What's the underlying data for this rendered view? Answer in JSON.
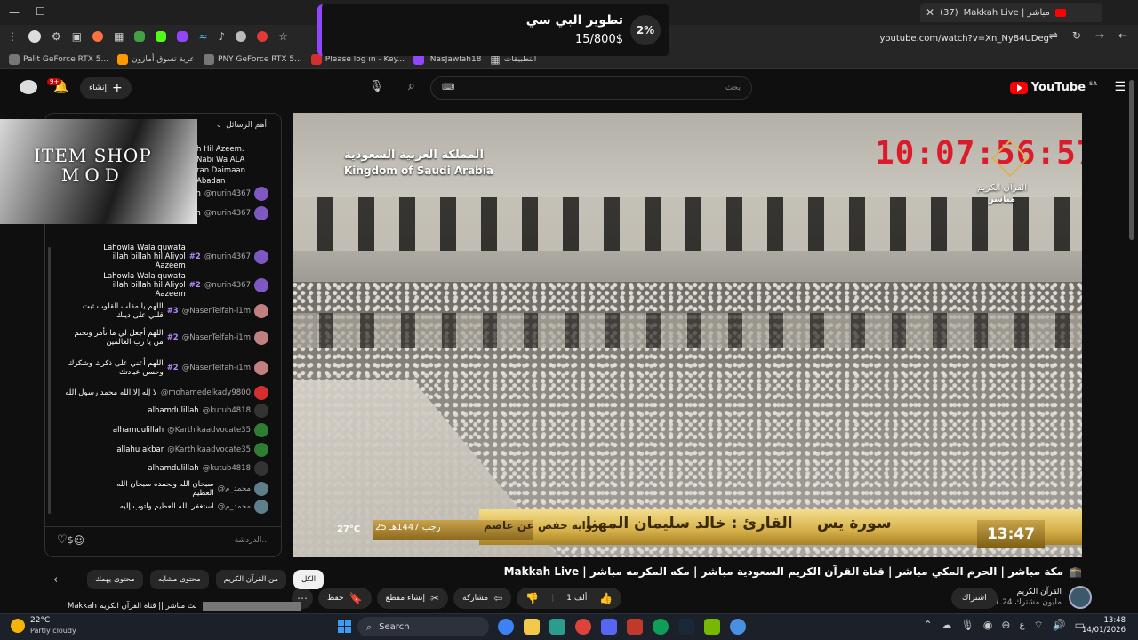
{
  "browser": {
    "tab_count_label": "(37)",
    "tab_title": "Makkah Live | مباشر",
    "new_tab_icon": "+",
    "url": "youtube.com/watch?v=Xn_Ny84UDeg",
    "bookmarks": [
      {
        "label": "التطبيقات",
        "color": "#4a4a4a"
      },
      {
        "label": "INasJawlah18",
        "color": "#9147ff"
      },
      {
        "label": "Please log in - Key...",
        "color": "#d32f2f"
      },
      {
        "label": "PNY GeForce RTX 5...",
        "color": "#555"
      },
      {
        "label": "عربة تسوق أمازون",
        "color": "#f90"
      },
      {
        "label": "Palit GeForce RTX 5...",
        "color": "#555"
      }
    ]
  },
  "donation": {
    "title": "تطوير البي سي",
    "amount": "15/800$",
    "percent": "2%"
  },
  "youtube": {
    "search_placeholder": "بحث",
    "logo_text": "YouTube",
    "logo_region": "SA",
    "create_label": "إنشاء",
    "notif_count": "9+"
  },
  "chat": {
    "header": "أهم الرسائل",
    "input_placeholder": "الدردشة...",
    "partial_top": [
      "h Hil Azeem.",
      "Nabi Wa ALA",
      "ran Daimaan",
      "Abadan"
    ],
    "messages": [
      {
        "user": "@nurin4367",
        "badge": "",
        "text": "iiaan abadan",
        "avatar": "#7e57c2"
      },
      {
        "user": "@nurin4367",
        "badge": "",
        "text": "billah hil Aliyol Aazeem",
        "avatar": "#7e57c2"
      },
      {
        "user": "@nurin4367",
        "badge": "#2",
        "text": "Lahowla Wala quwata illah billah hil Aliyol Aazeem",
        "avatar": "#7e57c2"
      },
      {
        "user": "@nurin4367",
        "badge": "#2",
        "text": "Lahowla Wala quwata illah billah hil Aliyol Aazeem",
        "avatar": "#7e57c2"
      },
      {
        "user": "@NaserTelfah-i1m",
        "badge": "#3",
        "text": "اللهم يا مقلب القلوب ثبت قلبي على دينك",
        "avatar": "#c08080"
      },
      {
        "user": "@NaserTelfah-i1m",
        "badge": "#2",
        "text": "اللهم أجعل لي ما تأمر وتحتم من يا رب العالمين",
        "avatar": "#c08080"
      },
      {
        "user": "@NaserTelfah-i1m",
        "badge": "#2",
        "text": "اللهم أعني على ذكرك وشكرك وحسن عبادتك",
        "avatar": "#c08080"
      },
      {
        "user": "@mohamedelkady9800",
        "badge": "",
        "text": "لا إله إلا الله محمد رسول الله",
        "avatar": "#d32f2f"
      },
      {
        "user": "@kutub4818",
        "badge": "",
        "text": "alhamdulillah",
        "avatar": "#333"
      },
      {
        "user": "@Karthikaadvocate35",
        "badge": "",
        "text": "alhamdulillah",
        "avatar": "#2e7d32"
      },
      {
        "user": "@Karthikaadvocate35",
        "badge": "",
        "text": "allahu akbar",
        "avatar": "#2e7d32"
      },
      {
        "user": "@kutub4818",
        "badge": "",
        "text": "alhamdulillah",
        "avatar": "#333"
      },
      {
        "user": "@محمد_م",
        "badge": "",
        "text": "سبحان الله وبحمده سبحان الله العظيم",
        "avatar": "#607d8b"
      },
      {
        "user": "@محمد_م",
        "badge": "",
        "text": "استغفر الله العظيم واتوب إليه",
        "avatar": "#607d8b"
      }
    ]
  },
  "overlay": {
    "shop_line1": "ITEM SHOP",
    "shop_line2": "MOD"
  },
  "video": {
    "channel_ar": "المملكة العربية السعودية",
    "channel_en": "Kingdom of Saudi Arabia",
    "clock": "10:07:56:57",
    "quran_label": "القرآن الكريم",
    "live_label": "مباشر",
    "sura": "سورة يس",
    "reader": "القارئ : خالد سليمان المهنا",
    "riwaya": "رواية حفص عن عاصم",
    "hijri": "25 رجب 1447هـ",
    "temperature": "27°C",
    "time": "13:47"
  },
  "below": {
    "title": "Makkah Live | مكة مباشر | الحرم المكي مباشر | قناة القرآن الكريم السعودية مباشر | مكه المكرمه مباشر",
    "channel_name": "القرآن الكريم",
    "subscribers": "1.24 مليون مشترك",
    "subscribe_label": "اشتراك",
    "like_count": "1 ألف",
    "share_label": "مشاركة",
    "clip_label": "إنشاء مقطع",
    "save_label": "حفظ",
    "chips": [
      "الكل",
      "من القرآن الكريم",
      "محتوى مشابه",
      "محتوى يهمك"
    ],
    "next_title": "Makkah بث مباشر || قناة القرآن الكريم"
  },
  "taskbar": {
    "weather_temp": "22°C",
    "weather_desc": "Partly cloudy",
    "search_label": "Search",
    "clock_time": "13:48",
    "clock_date": "14/01/2026",
    "lang": "ع",
    "app_colors": [
      "#3c82f6",
      "#f2c94c",
      "#2a9d8f",
      "#db4437",
      "#5865f2",
      "#c0392b",
      "#0f9d58",
      "#1b2838",
      "#76b900",
      "#4a90e2"
    ]
  }
}
